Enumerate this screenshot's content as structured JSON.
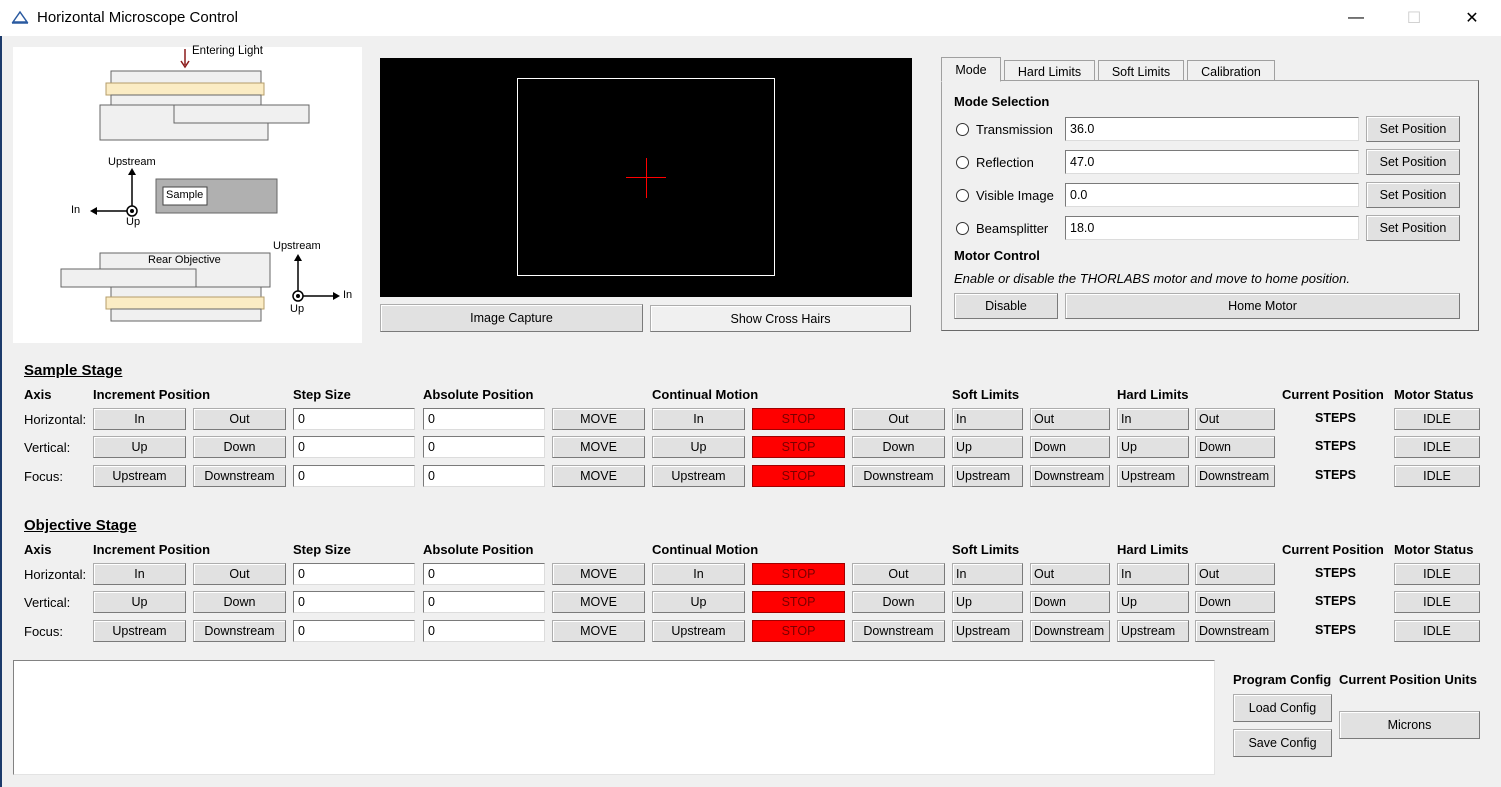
{
  "window": {
    "title": "Horizontal Microscope Control",
    "minimize": "—",
    "maximize": "☐",
    "close": "✕"
  },
  "diagram": {
    "entering_light": "Entering Light",
    "upstream_top": "Upstream",
    "in_left": "In",
    "up_left": "Up",
    "sample": "Sample",
    "rear_objective": "Rear Objective",
    "upstream_bottom": "Upstream",
    "up_right": "Up",
    "in_right": "In"
  },
  "camera": {
    "image_capture": "Image Capture",
    "show_cross_hairs": "Show Cross Hairs"
  },
  "tabs": [
    "Mode",
    "Hard Limits",
    "Soft Limits",
    "Calibration"
  ],
  "mode": {
    "heading": "Mode Selection",
    "rows": [
      {
        "label": "Transmission",
        "value": "36.0",
        "button": "Set Position"
      },
      {
        "label": "Reflection",
        "value": "47.0",
        "button": "Set Position"
      },
      {
        "label": "Visible Image",
        "value": "0.0",
        "button": "Set Position"
      },
      {
        "label": "Beamsplitter",
        "value": "18.0",
        "button": "Set Position"
      }
    ],
    "motor_heading": "Motor Control",
    "motor_desc": "Enable or disable the THORLABS motor and move to home position.",
    "disable": "Disable",
    "home": "Home Motor"
  },
  "headers": {
    "axis": "Axis",
    "increment": "Increment Position",
    "step": "Step Size",
    "absolute": "Absolute Position",
    "continual": "Continual Motion",
    "soft": "Soft Limits",
    "hard": "Hard Limits",
    "current": "Current Position",
    "status": "Motor Status"
  },
  "sample_stage": {
    "title": "Sample Stage",
    "rows": [
      {
        "axis": "Horizontal:",
        "neg": "In",
        "pos": "Out",
        "step": "0",
        "abs": "0",
        "move": "MOVE",
        "cneg": "In",
        "stop": "STOP",
        "cpos": "Out",
        "soft_neg": "In",
        "soft_pos": "Out",
        "hard_neg": "In",
        "hard_pos": "Out",
        "current": "STEPS",
        "status": "IDLE"
      },
      {
        "axis": "Vertical:",
        "neg": "Up",
        "pos": "Down",
        "step": "0",
        "abs": "0",
        "move": "MOVE",
        "cneg": "Up",
        "stop": "STOP",
        "cpos": "Down",
        "soft_neg": "Up",
        "soft_pos": "Down",
        "hard_neg": "Up",
        "hard_pos": "Down",
        "current": "STEPS",
        "status": "IDLE"
      },
      {
        "axis": "Focus:",
        "neg": "Upstream",
        "pos": "Downstream",
        "step": "0",
        "abs": "0",
        "move": "MOVE",
        "cneg": "Upstream",
        "stop": "STOP",
        "cpos": "Downstream",
        "soft_neg": "Upstream",
        "soft_pos": "Downstream",
        "hard_neg": "Upstream",
        "hard_pos": "Downstream",
        "current": "STEPS",
        "status": "IDLE"
      }
    ]
  },
  "objective_stage": {
    "title": "Objective Stage",
    "rows": [
      {
        "axis": "Horizontal:",
        "neg": "In",
        "pos": "Out",
        "step": "0",
        "abs": "0",
        "move": "MOVE",
        "cneg": "In",
        "stop": "STOP",
        "cpos": "Out",
        "soft_neg": "In",
        "soft_pos": "Out",
        "hard_neg": "In",
        "hard_pos": "Out",
        "current": "STEPS",
        "status": "IDLE"
      },
      {
        "axis": "Vertical:",
        "neg": "Up",
        "pos": "Down",
        "step": "0",
        "abs": "0",
        "move": "MOVE",
        "cneg": "Up",
        "stop": "STOP",
        "cpos": "Down",
        "soft_neg": "Up",
        "soft_pos": "Down",
        "hard_neg": "Up",
        "hard_pos": "Down",
        "current": "STEPS",
        "status": "IDLE"
      },
      {
        "axis": "Focus:",
        "neg": "Upstream",
        "pos": "Downstream",
        "step": "0",
        "abs": "0",
        "move": "MOVE",
        "cneg": "Upstream",
        "stop": "STOP",
        "cpos": "Downstream",
        "soft_neg": "Upstream",
        "soft_pos": "Downstream",
        "hard_neg": "Upstream",
        "hard_pos": "Downstream",
        "current": "STEPS",
        "status": "IDLE"
      }
    ]
  },
  "bottom": {
    "program_config": "Program Config",
    "load_config": "Load Config",
    "save_config": "Save Config",
    "units_heading": "Current Position Units",
    "units": "Microns"
  },
  "colors": {
    "stop": "#ff0000",
    "crosshair": "#ff0000",
    "camera_bg": "#000000"
  }
}
